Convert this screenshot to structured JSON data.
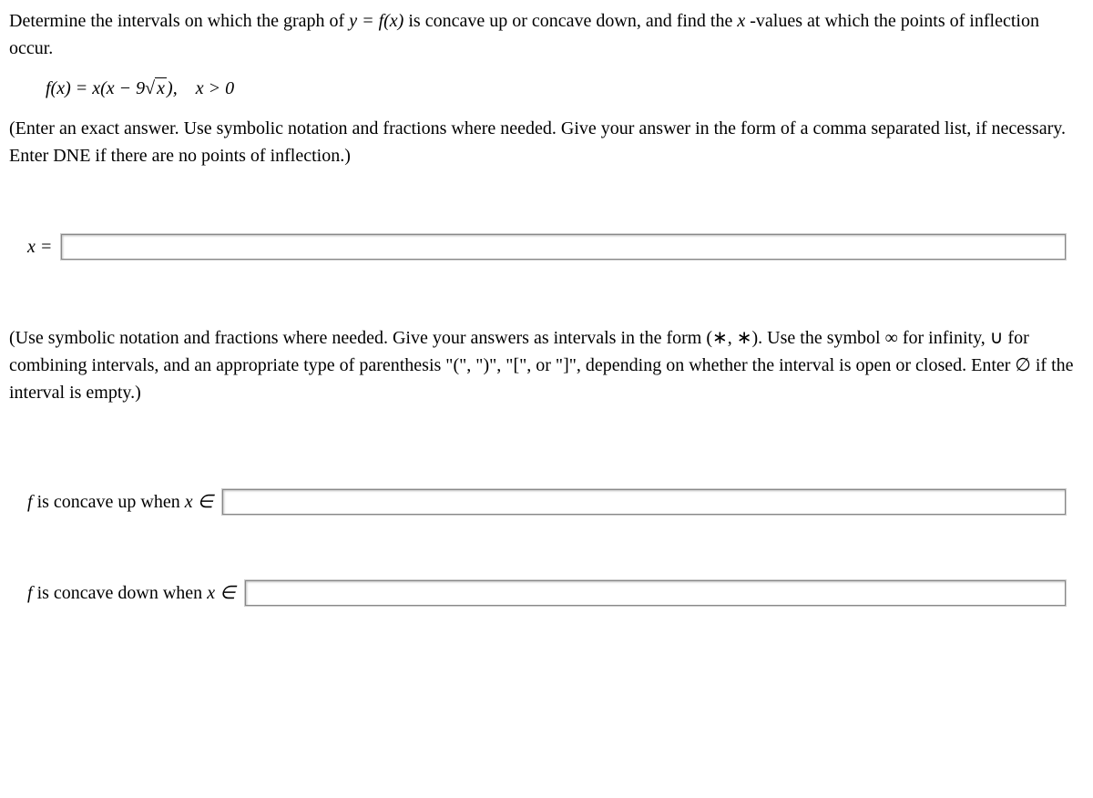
{
  "problem": {
    "intro_part1": "Determine the intervals on which the graph of ",
    "intro_math": "y = f(x)",
    "intro_part2": " is concave up or concave down, and find the ",
    "intro_xvar": "x",
    "intro_part3": "-values at which the points of inflection occur.",
    "formula_lhs": "f(x) = x(x − 9",
    "formula_radicand": "x",
    "formula_rhs": "),",
    "formula_condition": "x > 0",
    "instr1": "(Enter an exact answer. Use symbolic notation and fractions where needed. Give your answer in the form of a comma separated list, if necessary. Enter DNE if there are no points of inflection.)",
    "instr2": "(Use symbolic notation and fractions where needed. Give your answers as intervals in the form (∗, ∗). Use the symbol ∞ for infinity, ∪ for combining intervals, and an appropriate type of parenthesis \"(\", \")\", \"[\", or \"]\", depending on whether the interval is open or closed. Enter ∅ if the interval is empty.)"
  },
  "labels": {
    "x_equals": "x =",
    "concave_up_prefix": "f",
    "concave_up_mid": " is concave up when ",
    "concave_up_xin": "x ∈",
    "concave_down_prefix": "f",
    "concave_down_mid": " is concave down when ",
    "concave_down_xin": "x ∈"
  },
  "inputs": {
    "x_value": "",
    "concave_up": "",
    "concave_down": ""
  }
}
